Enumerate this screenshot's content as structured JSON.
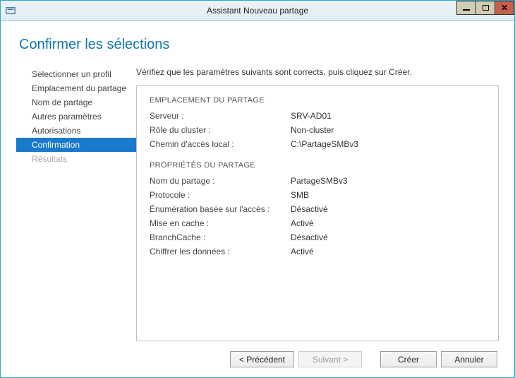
{
  "window": {
    "title": "Assistant Nouveau partage"
  },
  "heading": "Confirmer les sélections",
  "sidebar": {
    "items": [
      {
        "label": "Sélectionner un profil",
        "state": "normal"
      },
      {
        "label": "Emplacement du partage",
        "state": "normal"
      },
      {
        "label": "Nom de partage",
        "state": "normal"
      },
      {
        "label": "Autres paramètres",
        "state": "normal"
      },
      {
        "label": "Autorisations",
        "state": "normal"
      },
      {
        "label": "Confirmation",
        "state": "selected"
      },
      {
        "label": "Résultats",
        "state": "disabled"
      }
    ]
  },
  "main": {
    "instruction": "Vérifiez que les paramètres suivants sont corrects, puis cliquez sur Créer.",
    "section1": {
      "title": "EMPLACEMENT DU PARTAGE",
      "rows": [
        {
          "label": "Serveur :",
          "value": "SRV-AD01"
        },
        {
          "label": "Rôle du cluster :",
          "value": "Non-cluster"
        },
        {
          "label": "Chemin d'accès local :",
          "value": "C:\\PartageSMBv3"
        }
      ]
    },
    "section2": {
      "title": "PROPRIÉTÉS DU PARTAGE",
      "rows": [
        {
          "label": "Nom du partage :",
          "value": "PartageSMBv3"
        },
        {
          "label": "Protocole :",
          "value": "SMB"
        },
        {
          "label": "Énumération basée sur l'accès :",
          "value": "Désactivé"
        },
        {
          "label": "Mise en cache :",
          "value": "Activé"
        },
        {
          "label": "BranchCache :",
          "value": "Désactivé"
        },
        {
          "label": "Chiffrer les données :",
          "value": "Activé"
        }
      ]
    }
  },
  "buttons": {
    "previous": "< Précédent",
    "next": "Suivant >",
    "create": "Créer",
    "cancel": "Annuler"
  }
}
